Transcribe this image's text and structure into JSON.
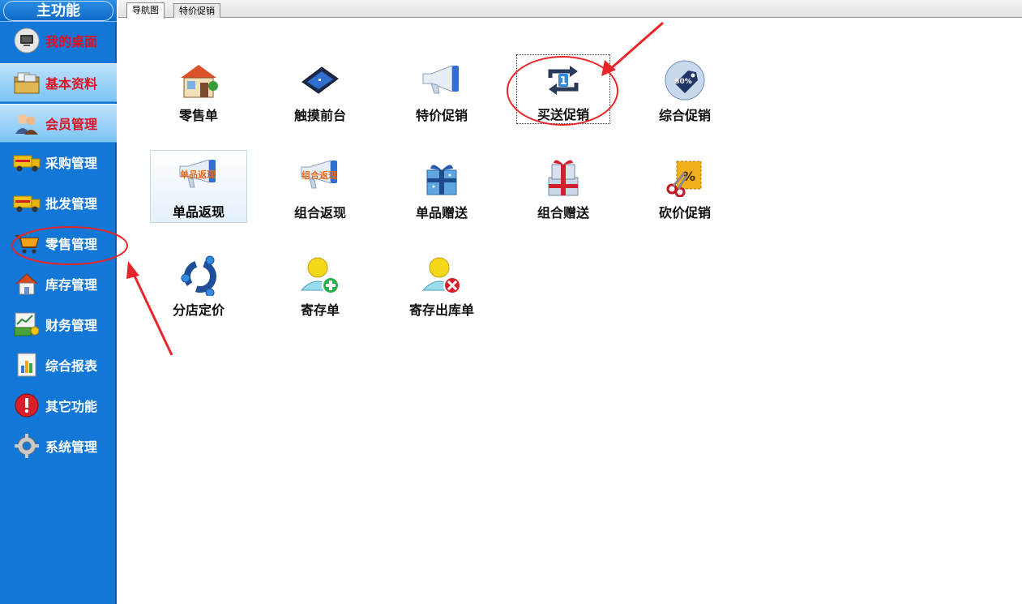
{
  "sidebar": {
    "title": "主功能",
    "items": [
      {
        "label": "我的桌面",
        "icon": "desktop-icon",
        "red": true,
        "active": false
      },
      {
        "label": "基本资料",
        "icon": "profile-folder-icon",
        "red": true,
        "active": true
      },
      {
        "label": "会员管理",
        "icon": "members-icon",
        "red": true,
        "active": true
      },
      {
        "label": "采购管理",
        "icon": "truck-icon",
        "red": false,
        "active": false
      },
      {
        "label": "批发管理",
        "icon": "truck-icon",
        "red": false,
        "active": false
      },
      {
        "label": "零售管理",
        "icon": "cart-icon",
        "red": false,
        "active": false
      },
      {
        "label": "库存管理",
        "icon": "house-icon",
        "red": false,
        "active": false
      },
      {
        "label": "财务管理",
        "icon": "finance-icon",
        "red": false,
        "active": false
      },
      {
        "label": "综合报表",
        "icon": "report-icon",
        "red": false,
        "active": false
      },
      {
        "label": "其它功能",
        "icon": "alert-icon",
        "red": false,
        "active": false
      },
      {
        "label": "系统管理",
        "icon": "gear-icon",
        "red": false,
        "active": false
      }
    ]
  },
  "tabs": [
    {
      "label": "导航图",
      "active": true
    },
    {
      "label": "特价促销",
      "active": false
    }
  ],
  "tiles": [
    {
      "label": "零售单",
      "icon": "store-icon"
    },
    {
      "label": "触摸前台",
      "icon": "touch-terminal-icon"
    },
    {
      "label": "特价促销",
      "icon": "megaphone-icon"
    },
    {
      "label": "买送促销",
      "icon": "repeat-one-icon"
    },
    {
      "label": "综合促销",
      "icon": "discount-tag-icon"
    },
    {
      "label": "单品返现",
      "icon": "megaphone-cashback-icon",
      "overlay": "单品返现"
    },
    {
      "label": "组合返现",
      "icon": "megaphone-cashback-icon",
      "overlay": "组合返现"
    },
    {
      "label": "单品赠送",
      "icon": "gift-icon"
    },
    {
      "label": "组合赠送",
      "icon": "gift-stack-icon"
    },
    {
      "label": "砍价促销",
      "icon": "scissors-percent-icon"
    },
    {
      "label": "分店定价",
      "icon": "branch-pricing-icon"
    },
    {
      "label": "寄存单",
      "icon": "user-add-icon"
    },
    {
      "label": "寄存出库单",
      "icon": "user-remove-icon"
    }
  ],
  "colors": {
    "sidebar_bg": "#1277d6",
    "annotation_red": "#e8262a"
  }
}
